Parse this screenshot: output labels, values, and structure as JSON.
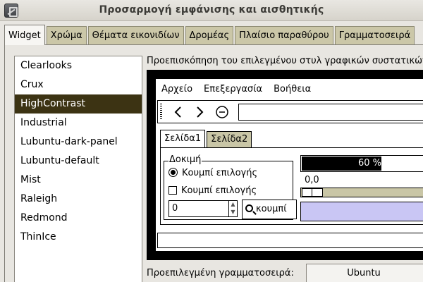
{
  "window": {
    "title": "Προσαρμογή εμφάνισης και αισθητικής",
    "icon": "appearance-settings-icon"
  },
  "tabs": [
    "Widget",
    "Χρώμα",
    "Θέματα εικονιδίων",
    "Δρομέας",
    "Πλαίσιο παραθύρου",
    "Γραμματοσειρά"
  ],
  "active_tab": "Widget",
  "themes": {
    "items": [
      "Clearlooks",
      "Crux",
      "HighContrast",
      "Industrial",
      "Lubuntu-dark-panel",
      "Lubuntu-default",
      "Mist",
      "Raleigh",
      "Redmond",
      "ThinIce"
    ],
    "selected": "HighContrast"
  },
  "preview": {
    "label": "Προεπισκόπηση του επιλεγμένου στυλ γραφικών συστατικών",
    "menu": [
      "Αρχείο",
      "Επεξεργασία",
      "Βοήθεια"
    ],
    "toolbar_icons": [
      "back-arrow-icon",
      "forward-arrow-icon",
      "stop-icon"
    ],
    "notebook_tabs": [
      "Σελίδα1",
      "Σελίδα2"
    ],
    "frame_label": "Δοκιμή",
    "radio_label": "Κουμπί επιλογής",
    "check_label": "Κουμπί επιλογής",
    "spin_value": "0",
    "find_button": "κουμπί",
    "progress_text": "60 %",
    "progress_fraction": 0.6,
    "scale_value": "0,0"
  },
  "font": {
    "label": "Προεπιλεγμένη γραμματοσειρά:",
    "value": "Ubuntu"
  },
  "colors": {
    "selected_bg": "#3c3313",
    "tab_bg": "#cbc7a8",
    "preview_bg": "#000000",
    "lavender": "#c9c6f4"
  }
}
